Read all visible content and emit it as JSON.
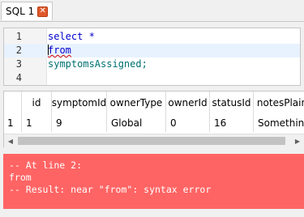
{
  "tab": {
    "label": "SQL 1",
    "close_icon": "close-icon",
    "close_color": "#e0582b"
  },
  "editor": {
    "lines": [
      {
        "num": "1",
        "text": "select *"
      },
      {
        "num": "2",
        "text": "from"
      },
      {
        "num": "3",
        "text": "symptomsAssigned;"
      },
      {
        "num": "4",
        "text": ""
      }
    ],
    "keyword_color": "#0000cc",
    "identifier_color": "#007070",
    "current_line": 2
  },
  "results": {
    "columns": [
      "id",
      "symptomId",
      "ownerType",
      "ownerId",
      "statusId",
      "notesPlain"
    ],
    "rows": [
      {
        "rownum": "1",
        "cells": [
          "1",
          "9",
          "Global",
          "0",
          "16",
          "Something"
        ]
      }
    ]
  },
  "error": {
    "lines": [
      "-- At line 2:",
      "from",
      "-- Result: near \"from\": syntax error"
    ],
    "background": "#ff6464"
  }
}
